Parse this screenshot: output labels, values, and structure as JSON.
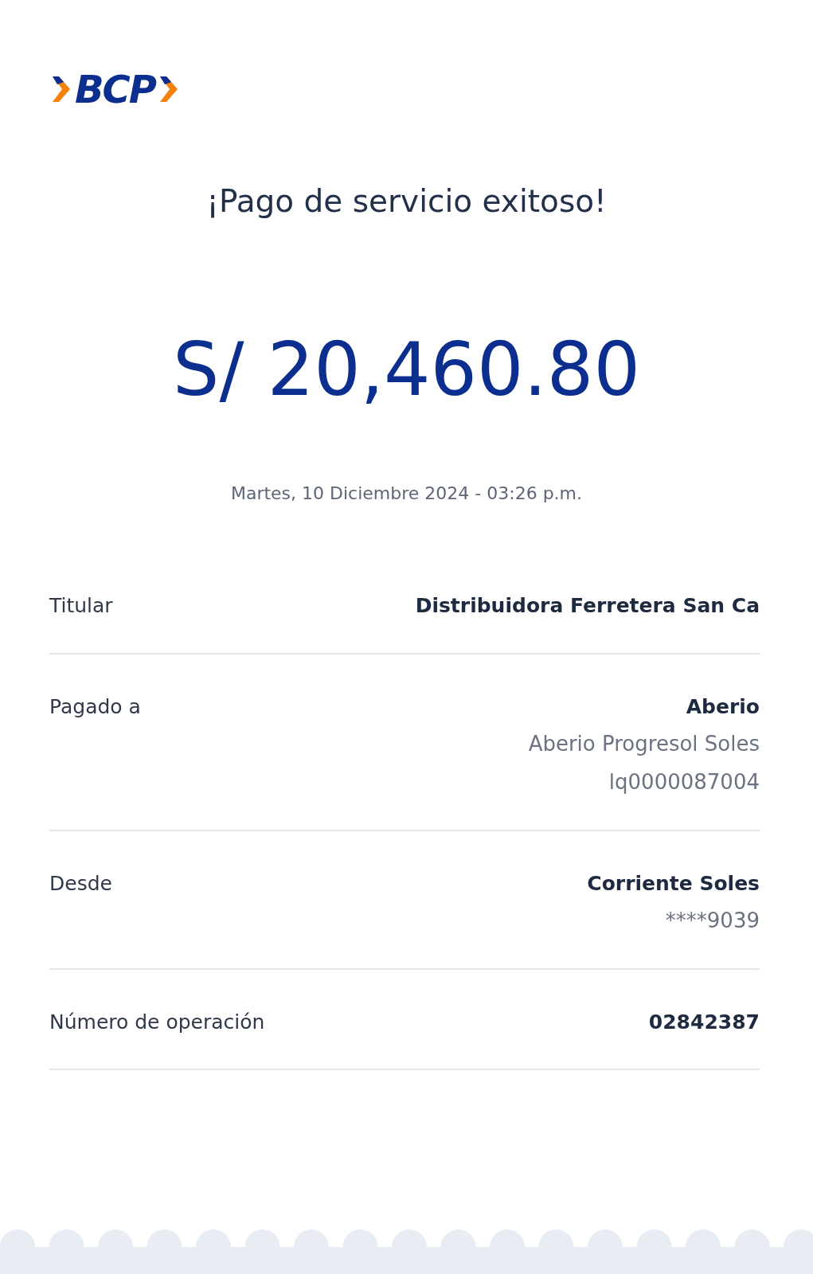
{
  "logo": {
    "text": "BCP"
  },
  "title": "¡Pago de servicio exitoso!",
  "amount": "S/ 20,460.80",
  "datetime": "Martes, 10 Diciembre 2024 - 03:26 p.m.",
  "details": [
    {
      "label": "Titular",
      "values": [
        {
          "kind": "primary",
          "text": "Distribuidora Ferretera San Ca"
        }
      ]
    },
    {
      "label": "Pagado a",
      "values": [
        {
          "kind": "primary",
          "text": "Aberio"
        },
        {
          "kind": "secondary",
          "text": "Aberio Progresol Soles"
        },
        {
          "kind": "secondary",
          "text": "lq0000087004"
        }
      ]
    },
    {
      "label": "Desde",
      "values": [
        {
          "kind": "primary",
          "text": "Corriente Soles"
        },
        {
          "kind": "secondary",
          "text": "****9039"
        }
      ]
    },
    {
      "label": "Número de operación",
      "values": [
        {
          "kind": "primary",
          "text": "02842387"
        }
      ]
    }
  ]
}
